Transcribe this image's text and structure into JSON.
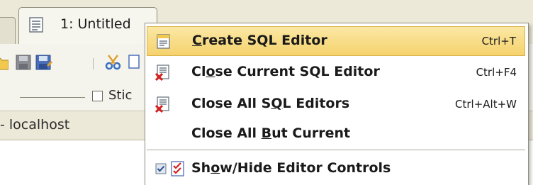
{
  "tabs": {
    "active_title": "1: Untitled"
  },
  "sticky": {
    "label": "Stic"
  },
  "connection": {
    "label": "- localhost"
  },
  "context_menu": {
    "items": [
      {
        "label_accel": "C",
        "label_rest": "reate SQL Editor",
        "shortcut": "Ctrl+T",
        "icon": "sql-editor-icon",
        "highlighted": true
      },
      {
        "label_pre": "Cl",
        "label_accel": "o",
        "label_rest": "se Current SQL Editor",
        "shortcut": "Ctrl+F4",
        "icon": "close-editor-icon"
      },
      {
        "label_pre": "Close All S",
        "label_accel": "Q",
        "label_rest": "L Editors",
        "shortcut": "Ctrl+Alt+W",
        "icon": "close-all-editors-icon"
      },
      {
        "label_pre": "Close All ",
        "label_accel": "B",
        "label_rest": "ut Current",
        "shortcut": ""
      },
      {
        "label_pre": "Sh",
        "label_accel": "o",
        "label_rest": "w/Hide Editor Controls",
        "shortcut": "",
        "icon": "checklist-icon",
        "checked": true
      }
    ]
  },
  "colors": {
    "highlight": "#f5d26d",
    "chrome": "#ece9d8",
    "menu_bg": "#ffffff"
  }
}
